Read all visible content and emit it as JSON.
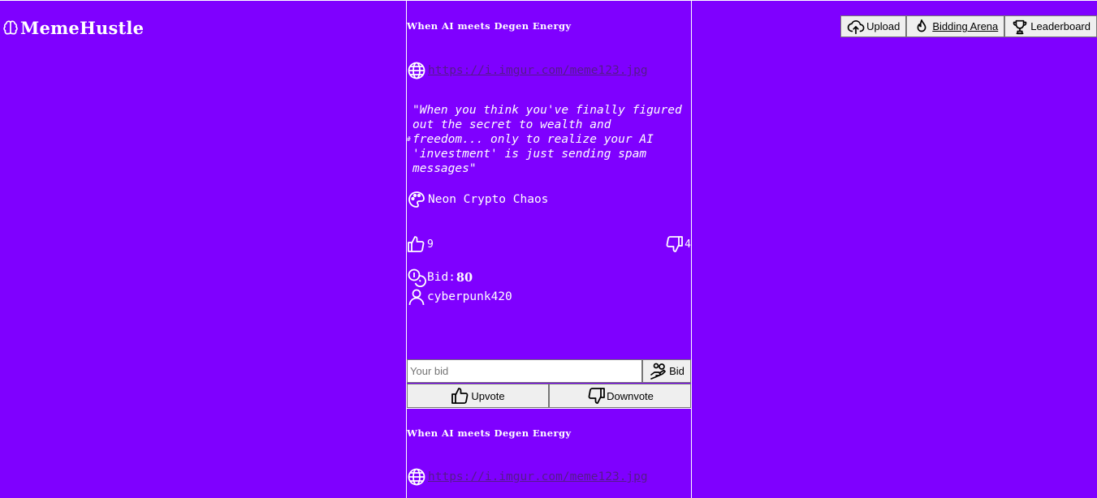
{
  "app": {
    "name": "MemeHustle"
  },
  "nav": [
    {
      "label": "Upload",
      "icon": "upload-cloud-icon"
    },
    {
      "label": "Bidding Arena",
      "icon": "flame-icon"
    },
    {
      "label": "Leaderboard",
      "icon": "trophy-icon"
    }
  ],
  "memes": [
    {
      "title": "When AI meets Degen Energy",
      "url": "https://i.imgur.com/meme123.jpg",
      "caption": "\"When you think you've finally figured out the secret to wealth and freedom... only to realize your AI 'investment' is just sending spam messages\"",
      "caption_prefix": "#",
      "vibe": "Neon Crypto Chaos",
      "upvotes": "9",
      "downvotes": "4",
      "bid_label": "Bid:",
      "bid_value": "80",
      "owner": "cyberpunk420",
      "bid_placeholder": "Your bid",
      "bid_button": "Bid",
      "upvote_button": "Upvote",
      "downvote_button": "Downvote"
    },
    {
      "title": "When AI meets Degen Energy",
      "url": "https://i.imgur.com/meme123.jpg"
    }
  ]
}
